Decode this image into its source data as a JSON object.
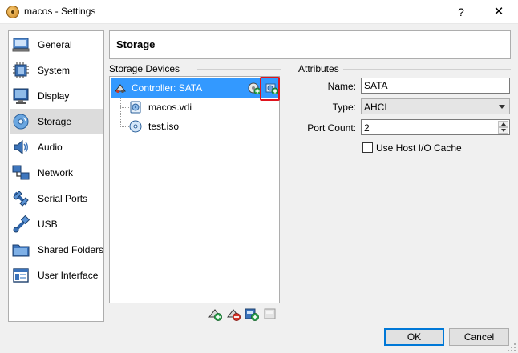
{
  "window": {
    "title": "macos - Settings",
    "help_glyph": "?",
    "close_glyph": "✕"
  },
  "nav": {
    "items": [
      {
        "label": "General",
        "icon": "general-icon"
      },
      {
        "label": "System",
        "icon": "system-chip-icon"
      },
      {
        "label": "Display",
        "icon": "display-monitor-icon"
      },
      {
        "label": "Storage",
        "icon": "storage-disk-icon",
        "selected": true
      },
      {
        "label": "Audio",
        "icon": "audio-speaker-icon"
      },
      {
        "label": "Network",
        "icon": "network-icon"
      },
      {
        "label": "Serial Ports",
        "icon": "serial-port-icon"
      },
      {
        "label": "USB",
        "icon": "usb-icon"
      },
      {
        "label": "Shared Folders",
        "icon": "shared-folder-icon"
      },
      {
        "label": "User Interface",
        "icon": "user-interface-icon"
      }
    ]
  },
  "header": {
    "title": "Storage"
  },
  "storage_devices": {
    "label": "Storage Devices",
    "controller": {
      "label": "Controller: SATA"
    },
    "children": [
      {
        "label": "macos.vdi",
        "icon": "hard-disk-icon"
      },
      {
        "label": "test.iso",
        "icon": "optical-disc-icon"
      }
    ]
  },
  "attributes": {
    "label": "Attributes",
    "name_label": "Name:",
    "name_value": "SATA",
    "type_label": "Type:",
    "type_value": "AHCI",
    "port_count_label": "Port Count:",
    "port_count_value": "2",
    "host_io_cache_label": "Use Host I/O Cache",
    "host_io_cache_checked": false
  },
  "buttons": {
    "ok": "OK",
    "cancel": "Cancel"
  },
  "colors": {
    "selection": "#3399ff",
    "highlight": "#e0141e",
    "accent": "#0078d7"
  }
}
